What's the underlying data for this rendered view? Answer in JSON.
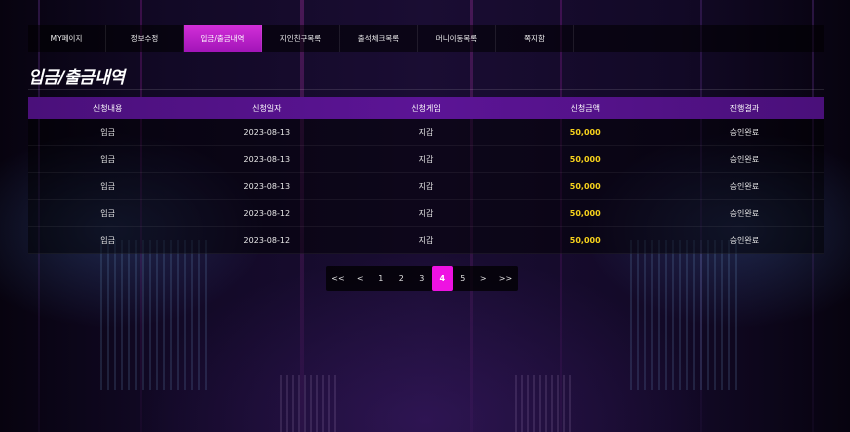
{
  "nav": {
    "tabs": [
      {
        "label": "MY페이지"
      },
      {
        "label": "정보수정"
      },
      {
        "label": "입금/출금내역"
      },
      {
        "label": "지인친구목록"
      },
      {
        "label": "출석체크목록"
      },
      {
        "label": "머니이동목록"
      },
      {
        "label": "쪽지함"
      }
    ],
    "active_index": 2
  },
  "page": {
    "title": "입금/출금내역"
  },
  "table": {
    "headers": [
      "신청내용",
      "신청일자",
      "신청게임",
      "신청금액",
      "진행결과"
    ],
    "rows": [
      {
        "type": "입금",
        "date": "2023-08-13",
        "game": "지갑",
        "amount": "50,000",
        "status": "승인완료"
      },
      {
        "type": "입금",
        "date": "2023-08-13",
        "game": "지갑",
        "amount": "50,000",
        "status": "승인완료"
      },
      {
        "type": "입금",
        "date": "2023-08-13",
        "game": "지갑",
        "amount": "50,000",
        "status": "승인완료"
      },
      {
        "type": "입금",
        "date": "2023-08-12",
        "game": "지갑",
        "amount": "50,000",
        "status": "승인완료"
      },
      {
        "type": "입금",
        "date": "2023-08-12",
        "game": "지갑",
        "amount": "50,000",
        "status": "승인완료"
      }
    ]
  },
  "pagination": {
    "first": "<<",
    "prev": "<",
    "pages": [
      "1",
      "2",
      "3",
      "4",
      "5"
    ],
    "current": "4",
    "next": ">",
    "last": ">>"
  },
  "colors": {
    "active_tab": "#c21fc9",
    "header_bar": "#5c1496",
    "amount": "#f7d21c",
    "active_page": "#ee12e2"
  }
}
